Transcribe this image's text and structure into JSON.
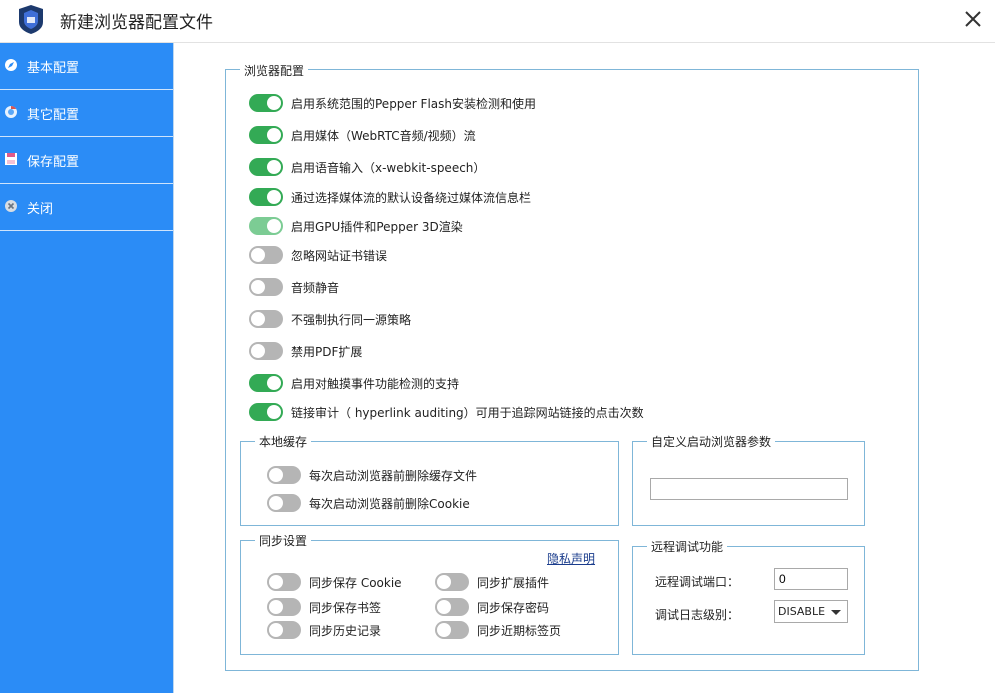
{
  "window": {
    "title": "新建浏览器配置文件"
  },
  "sidebar": {
    "items": [
      {
        "label": "基本配置",
        "icon": "compass-icon"
      },
      {
        "label": "其它配置",
        "icon": "chrome-icon"
      },
      {
        "label": "保存配置",
        "icon": "save-icon"
      },
      {
        "label": "关闭",
        "icon": "close-circle-icon"
      }
    ]
  },
  "browser_config": {
    "legend": "浏览器配置",
    "options": [
      {
        "label": "启用系统范围的Pepper Flash安装检测和使用",
        "on": true
      },
      {
        "label": "启用媒体（WebRTC音频/视频）流",
        "on": true
      },
      {
        "label": "启用语音输入（x-webkit-speech）",
        "on": true
      },
      {
        "label": "通过选择媒体流的默认设备绕过媒体流信息栏",
        "on": true
      },
      {
        "label": "启用GPU插件和Pepper 3D渲染",
        "on": true
      },
      {
        "label": "忽略网站证书错误",
        "on": false
      },
      {
        "label": "音频静音",
        "on": false
      },
      {
        "label": "不强制执行同一源策略",
        "on": false
      },
      {
        "label": "禁用PDF扩展",
        "on": false
      },
      {
        "label": "启用对触摸事件功能检测的支持",
        "on": true
      },
      {
        "label": "链接审计（ hyperlink auditing）可用于追踪网站链接的点击次数",
        "on": true
      }
    ]
  },
  "local_cache": {
    "legend": "本地缓存",
    "options": [
      {
        "label": "每次启动浏览器前删除缓存文件",
        "on": false
      },
      {
        "label": "每次启动浏览器前删除Cookie",
        "on": false
      }
    ]
  },
  "custom_args": {
    "legend": "自定义启动浏览器参数",
    "value": ""
  },
  "sync": {
    "legend": "同步设置",
    "privacy_link": "隐私声明",
    "options": [
      {
        "label": "同步保存 Cookie",
        "on": false
      },
      {
        "label": "同步扩展插件",
        "on": false
      },
      {
        "label": "同步保存书签",
        "on": false
      },
      {
        "label": "同步保存密码",
        "on": false
      },
      {
        "label": "同步历史记录",
        "on": false
      },
      {
        "label": "同步近期标签页",
        "on": false
      }
    ]
  },
  "remote_debug": {
    "legend": "远程调试功能",
    "port_label": "远程调试端口：",
    "port_value": "0",
    "log_label": "调试日志级别：",
    "log_value": "DISABLE"
  },
  "colors": {
    "sidebar": "#2b8cf6",
    "toggle_on": "#33aa55",
    "toggle_off": "#b5b5b5",
    "group_border": "#7fb6d8"
  }
}
